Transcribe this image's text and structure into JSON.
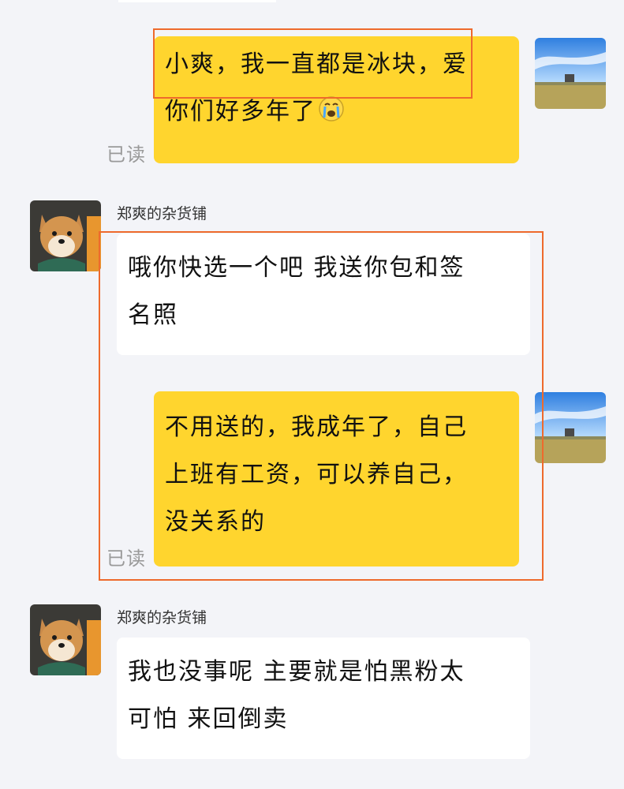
{
  "messages": [
    {
      "from": "self",
      "lines": [
        "小爽，我一直都是冰块，爱",
        "你们好多年了"
      ],
      "emoji": "crying-face-icon",
      "read_status": "已读"
    },
    {
      "from": "other",
      "sender": "郑爽的杂货铺",
      "lines": [
        "哦你快选一个吧 我送你包和签",
        "名照"
      ]
    },
    {
      "from": "self",
      "lines": [
        "不用送的，我成年了，自己",
        "上班有工资，可以养自己，",
        "没关系的"
      ],
      "read_status": "已读"
    },
    {
      "from": "other",
      "sender": "郑爽的杂货铺",
      "lines": [
        "我也没事呢 主要就是怕黑粉太",
        "可怕 来回倒卖"
      ]
    }
  ],
  "avatars": {
    "self": "landscape-avatar",
    "other": "shiba-dog-avatar"
  },
  "colors": {
    "background": "#f3f4f8",
    "self_bubble": "#ffd52e",
    "other_bubble": "#ffffff",
    "highlight_frame": "#ee6a2c"
  }
}
